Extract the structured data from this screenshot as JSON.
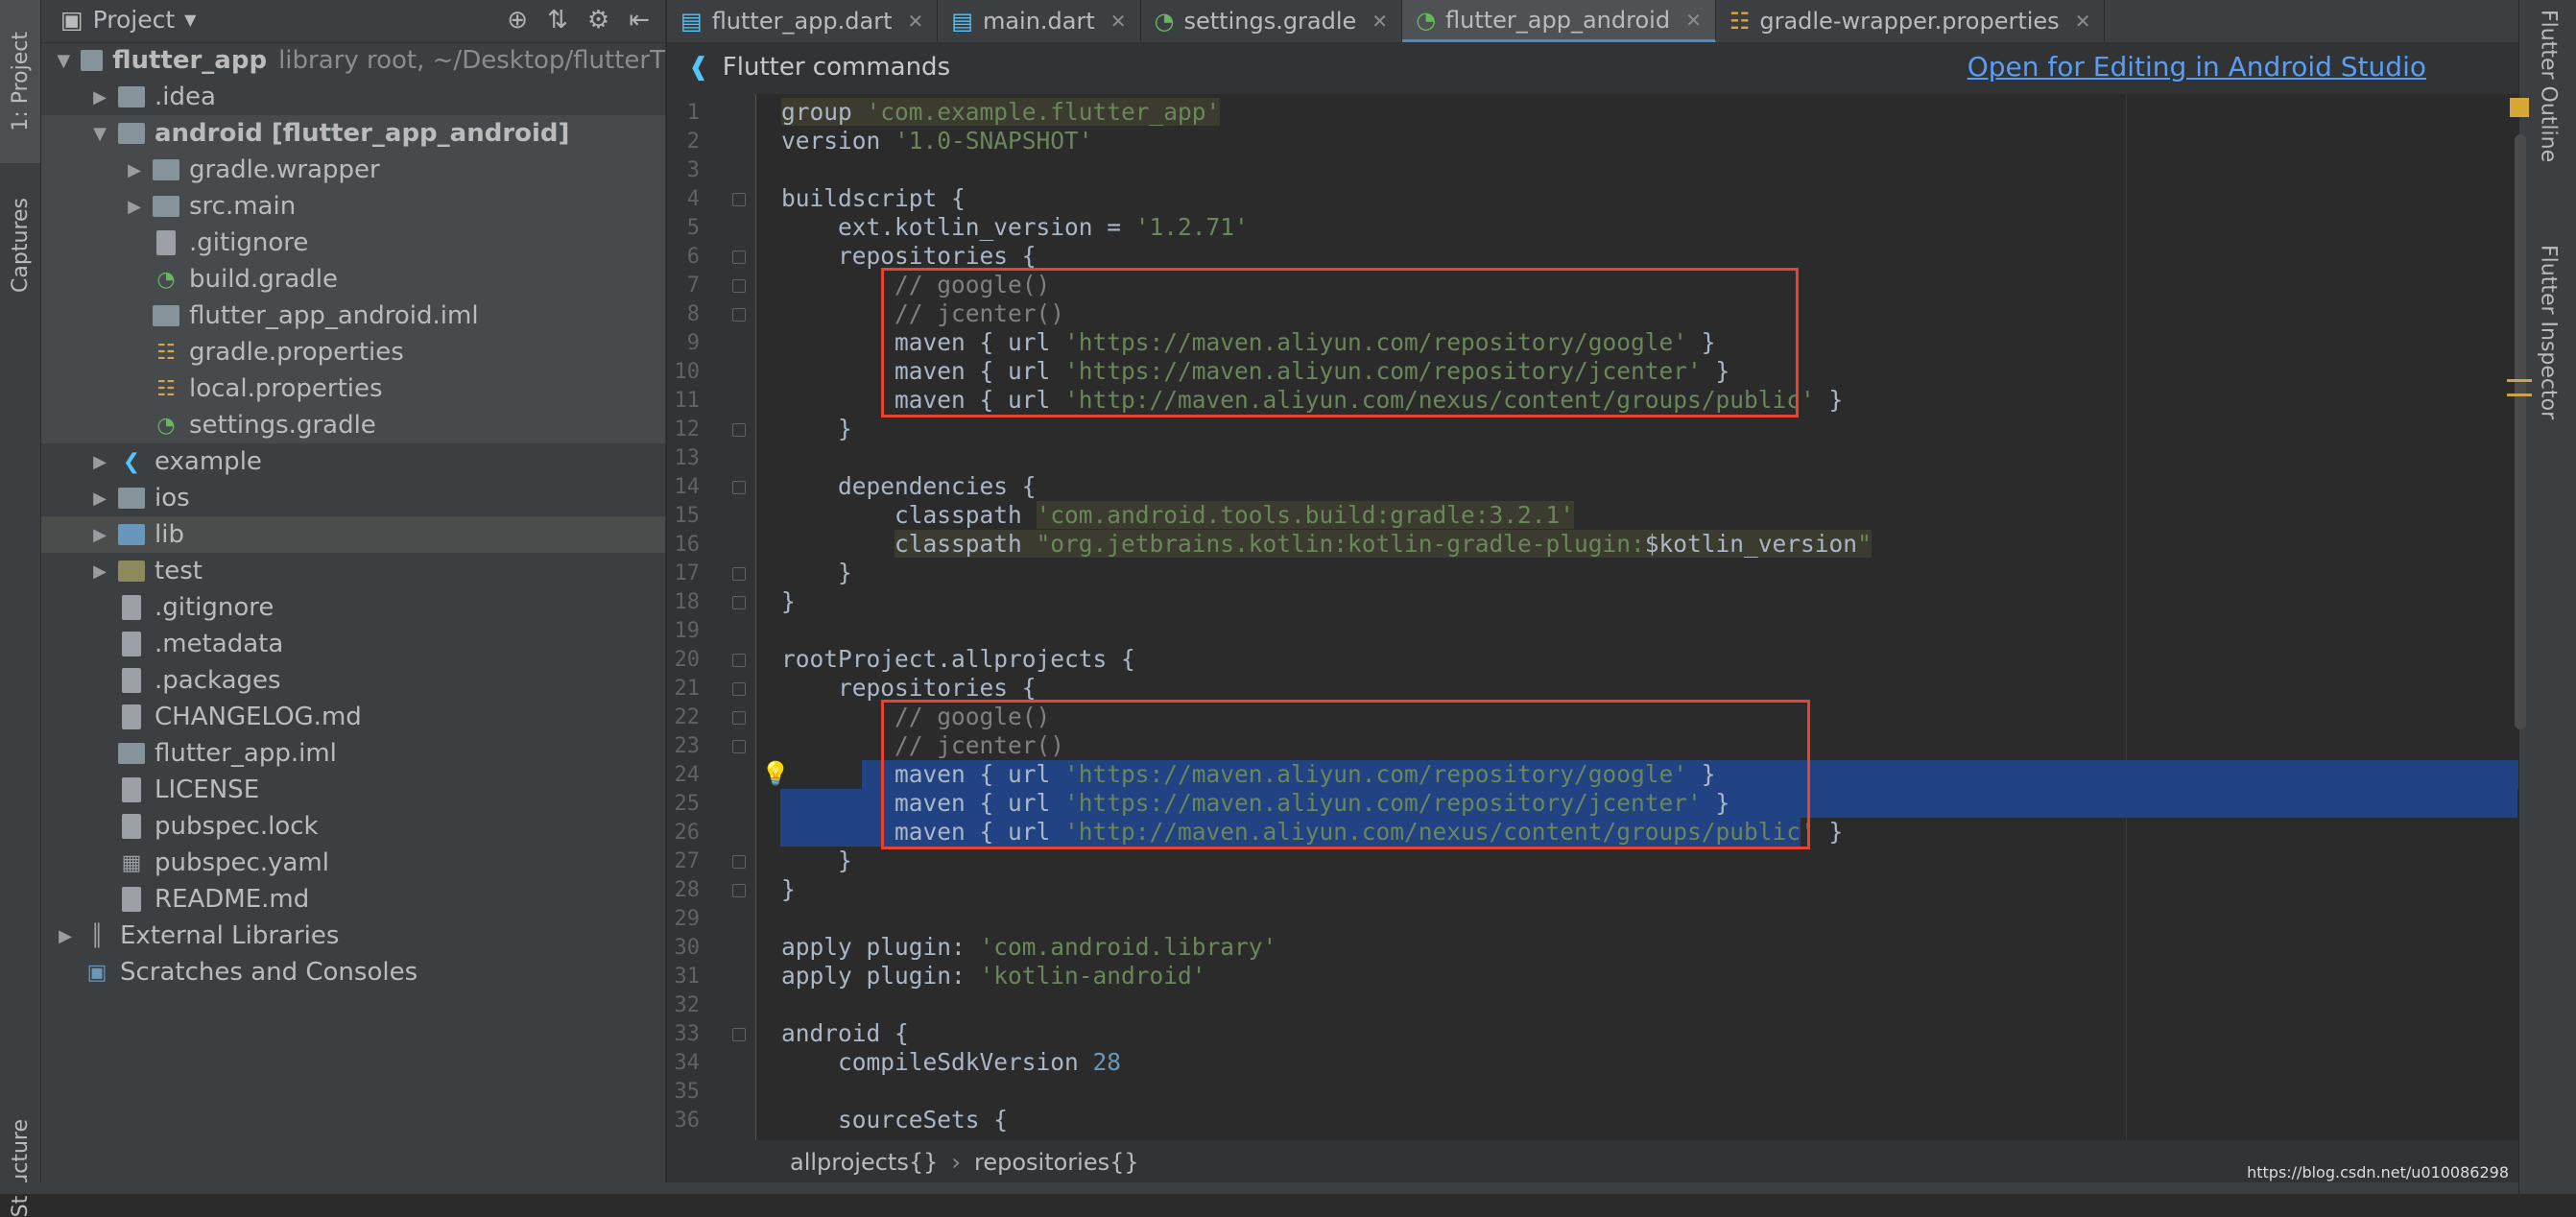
{
  "left_strip": {
    "project_tab": "1: Project",
    "captures_tab": "Captures",
    "structure_tab": "Structure"
  },
  "panel": {
    "title": "Project",
    "tree": [
      {
        "label": "flutter_app",
        "extra": "library root, ~/Desktop/flutterT",
        "indent": 0,
        "expanded": true,
        "icon": "folder"
      },
      {
        "label": ".idea",
        "indent": 1,
        "expanded": false,
        "icon": "folder"
      },
      {
        "label": "android [flutter_app_android]",
        "indent": 1,
        "expanded": true,
        "icon": "folder"
      },
      {
        "label": "gradle.wrapper",
        "indent": 2,
        "expanded": false,
        "icon": "folder"
      },
      {
        "label": "src.main",
        "indent": 2,
        "expanded": false,
        "icon": "folder"
      },
      {
        "label": ".gitignore",
        "indent": 2,
        "icon": "file"
      },
      {
        "label": "build.gradle",
        "indent": 2,
        "icon": "gradle"
      },
      {
        "label": "flutter_app_android.iml",
        "indent": 2,
        "icon": "iml"
      },
      {
        "label": "gradle.properties",
        "indent": 2,
        "icon": "properties"
      },
      {
        "label": "local.properties",
        "indent": 2,
        "icon": "properties"
      },
      {
        "label": "settings.gradle",
        "indent": 2,
        "icon": "gradle"
      },
      {
        "label": "example",
        "indent": 1,
        "expanded": false,
        "icon": "flutter"
      },
      {
        "label": "ios",
        "indent": 1,
        "expanded": false,
        "icon": "folder"
      },
      {
        "label": "lib",
        "indent": 1,
        "expanded": false,
        "icon": "folder-blue"
      },
      {
        "label": "test",
        "indent": 1,
        "expanded": false,
        "icon": "folder-olive"
      },
      {
        "label": ".gitignore",
        "indent": 1,
        "icon": "file"
      },
      {
        "label": ".metadata",
        "indent": 1,
        "icon": "file"
      },
      {
        "label": ".packages",
        "indent": 1,
        "icon": "file"
      },
      {
        "label": "CHANGELOG.md",
        "indent": 1,
        "icon": "file"
      },
      {
        "label": "flutter_app.iml",
        "indent": 1,
        "icon": "iml"
      },
      {
        "label": "LICENSE",
        "indent": 1,
        "icon": "file"
      },
      {
        "label": "pubspec.lock",
        "indent": 1,
        "icon": "file"
      },
      {
        "label": "pubspec.yaml",
        "indent": 1,
        "icon": "yaml"
      },
      {
        "label": "README.md",
        "indent": 1,
        "icon": "file"
      },
      {
        "label": "External Libraries",
        "indent": 0,
        "expanded": false,
        "icon": "libraries"
      },
      {
        "label": "Scratches and Consoles",
        "indent": 0,
        "icon": "scratches"
      }
    ]
  },
  "tabs": [
    {
      "label": "flutter_app.dart",
      "icon": "dart-file-icon",
      "active": false
    },
    {
      "label": "main.dart",
      "icon": "dart-file-icon",
      "active": false
    },
    {
      "label": "settings.gradle",
      "icon": "gradle-icon",
      "active": false
    },
    {
      "label": "flutter_app_android",
      "icon": "gradle-icon",
      "active": true
    },
    {
      "label": "gradle-wrapper.properties",
      "icon": "properties-icon",
      "active": false
    }
  ],
  "notification": {
    "title": "Flutter commands",
    "link": "Open for Editing in Android Studio"
  },
  "code_lines": [
    [
      [
        "strbgw",
        "group "
      ],
      [
        "strbg",
        "'com.example.flutter_app'"
      ]
    ],
    [
      [
        "t",
        "version "
      ],
      [
        "str",
        "'1.0-SNAPSHOT'"
      ]
    ],
    [],
    [
      [
        "t",
        "buildscript {"
      ]
    ],
    [
      [
        "t",
        "    ext.kotlin_version = "
      ],
      [
        "str",
        "'1.2.71'"
      ]
    ],
    [
      [
        "t",
        "    repositories {"
      ]
    ],
    [
      [
        "cmt",
        "        // google()"
      ]
    ],
    [
      [
        "cmt",
        "        // jcenter()"
      ]
    ],
    [
      [
        "t",
        "        maven { url "
      ],
      [
        "str",
        "'https://maven.aliyun.com/repository/google'"
      ],
      [
        "t",
        " }"
      ]
    ],
    [
      [
        "t",
        "        maven { url "
      ],
      [
        "str",
        "'https://maven.aliyun.com/repository/jcenter'"
      ],
      [
        "t",
        " }"
      ]
    ],
    [
      [
        "t",
        "        maven { url "
      ],
      [
        "str",
        "'http://maven.aliyun.com/nexus/content/groups/public'"
      ],
      [
        "t",
        " }"
      ]
    ],
    [
      [
        "t",
        "    }"
      ]
    ],
    [],
    [
      [
        "t",
        "    dependencies {"
      ]
    ],
    [
      [
        "t",
        "        classpath "
      ],
      [
        "strbg",
        "'com.android.tools.build:gradle:3.2.1'"
      ]
    ],
    [
      [
        "t",
        "        "
      ],
      [
        "strbgw",
        "classpath "
      ],
      [
        "strbg",
        "\"org.jetbrains.kotlin:kotlin-gradle-plugin:"
      ],
      [
        "strbgw",
        "$kotlin_version"
      ],
      [
        "strbg",
        "\""
      ]
    ],
    [
      [
        "t",
        "    }"
      ]
    ],
    [
      [
        "t",
        "}"
      ]
    ],
    [],
    [
      [
        "t",
        "rootProject.allprojects {"
      ]
    ],
    [
      [
        "t",
        "    repositories {"
      ]
    ],
    [
      [
        "cmt",
        "        // google()"
      ]
    ],
    [
      [
        "cmt",
        "        // jcenter()"
      ]
    ],
    [
      [
        "t",
        "        maven { url "
      ],
      [
        "str",
        "'https://maven.aliyun.com/repository/google'"
      ],
      [
        "t",
        " }"
      ]
    ],
    [
      [
        "t",
        "        maven { url "
      ],
      [
        "str",
        "'https://maven.aliyun.com/repository/jcenter'"
      ],
      [
        "t",
        " }"
      ]
    ],
    [
      [
        "t",
        "        maven { url "
      ],
      [
        "str",
        "'http://maven.aliyun.com/nexus/content/groups/public'"
      ],
      [
        "t",
        " }"
      ]
    ],
    [
      [
        "t",
        "    }"
      ]
    ],
    [
      [
        "t",
        "}"
      ]
    ],
    [],
    [
      [
        "t",
        "apply plugin: "
      ],
      [
        "str",
        "'com.android.library'"
      ]
    ],
    [
      [
        "t",
        "apply plugin: "
      ],
      [
        "str",
        "'kotlin-android'"
      ]
    ],
    [],
    [
      [
        "t",
        "android {"
      ]
    ],
    [
      [
        "t",
        "    compileSdkVersion "
      ],
      [
        "num",
        "28"
      ]
    ],
    [],
    [
      [
        "t",
        "    sourceSets {"
      ]
    ]
  ],
  "breadcrumb": [
    "allprojects{}",
    "repositories{}"
  ],
  "right_strip": {
    "outline_tab": "Flutter Outline",
    "inspector_tab": "Flutter Inspector"
  },
  "watermark": "https://blog.csdn.net/u010086298",
  "colors": {
    "accent": "#4a88c7",
    "highlight_box": "#e8432e",
    "selection": "#214283",
    "link": "#589df6"
  }
}
